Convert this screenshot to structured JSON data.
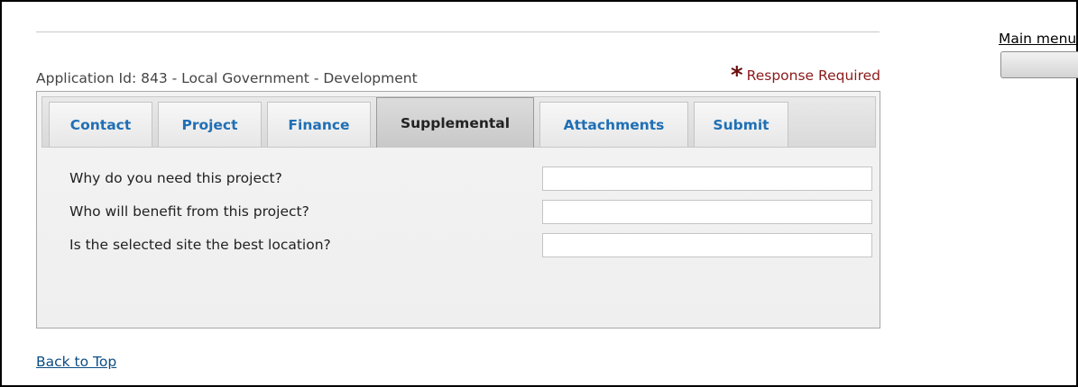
{
  "header": {
    "application_label": "Application Id: 843 - Local Government - Development",
    "required_legend": "Response Required",
    "required_icon": "asterisk-icon"
  },
  "tabs": [
    {
      "label": "Contact",
      "active": false
    },
    {
      "label": "Project",
      "active": false
    },
    {
      "label": "Finance",
      "active": false
    },
    {
      "label": "Supplemental",
      "active": true
    },
    {
      "label": "Attachments",
      "active": false
    },
    {
      "label": "Submit",
      "active": false
    }
  ],
  "form": {
    "questions": [
      {
        "label": "Why do you need this project?",
        "value": ""
      },
      {
        "label": "Who will benefit from this project?",
        "value": ""
      },
      {
        "label": "Is the selected site the best location?",
        "value": ""
      }
    ]
  },
  "footer": {
    "back_to_top": "Back to Top"
  },
  "sidebar": {
    "main_menu_label": "Main menu",
    "menu_button_label": ""
  },
  "colors": {
    "tab_link": "#1f6fb5",
    "required": "#8b1a1a",
    "link": "#0b4d84"
  }
}
